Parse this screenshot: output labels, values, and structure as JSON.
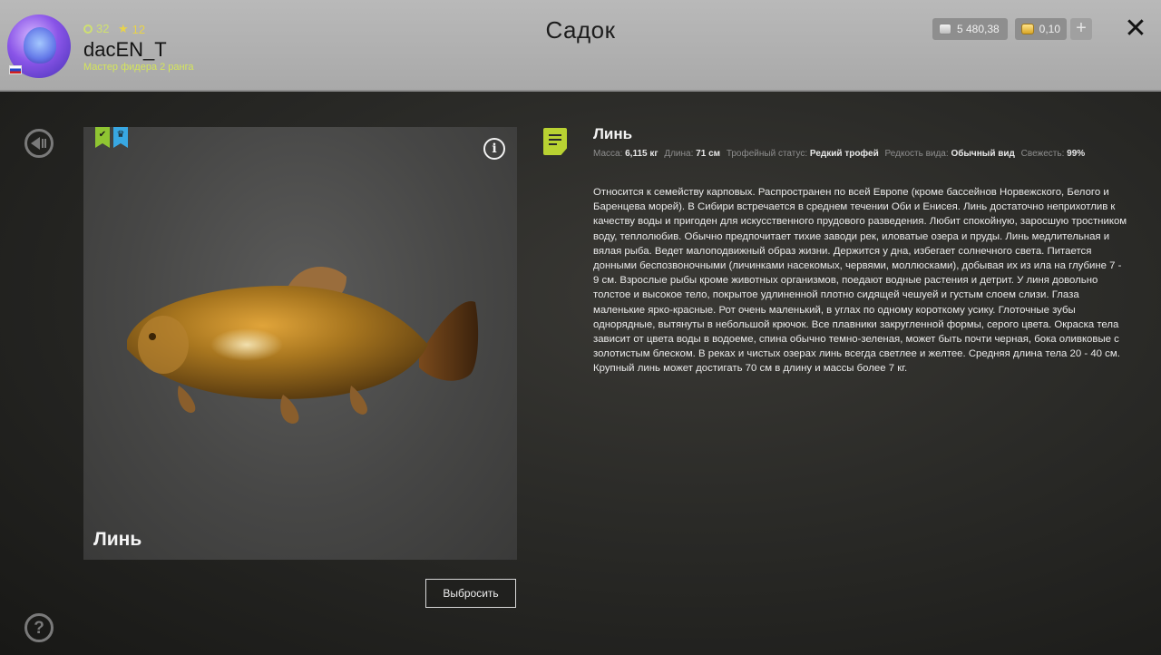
{
  "header": {
    "title": "Садок",
    "username": "dacEN_T",
    "rank": "Мастер фидера 2 ранга",
    "coins_count": "32",
    "stars_count": "12",
    "silver_balance": "5 480,38",
    "gold_balance": "0,10",
    "plus_label": "+",
    "close_label": "✕"
  },
  "fish": {
    "panel_name": "Линь",
    "discard_label": "Выбросить"
  },
  "info": {
    "title": "Линь",
    "mass_label": "Масса:",
    "mass_value": "6,115 кг",
    "length_label": "Длина:",
    "length_value": "71 см",
    "trophy_label": "Трофейный статус:",
    "trophy_value": "Редкий трофей",
    "rarity_label": "Редкость вида:",
    "rarity_value": "Обычный вид",
    "fresh_label": "Свежесть:",
    "fresh_value": "99%",
    "description": "Относится к семейству карповых. Распространен по всей Европе (кроме бассейнов Норвежского, Белого и Баренцева морей). В Сибири встречается в среднем течении Оби и Енисея. Линь достаточно неприхотлив к качеству воды и пригоден для искусственного прудового разведения. Любит спокойную, заросшую тростником воду, теплолюбив. Обычно предпочитает тихие заводи рек, иловатые озера и пруды. Линь медлительная и вялая рыба. Ведет малоподвижный образ жизни. Держится у дна, избегает солнечного света. Питается донными беспозвоночными (личинками насекомых, червями, моллюсками), добывая их из ила на глубине 7 - 9 см. Взрослые рыбы кроме животных организмов, поедают водные растения и детрит. У линя довольно толстое и высокое тело, покрытое удлиненной плотно сидящей чешуей и густым слоем слизи. Глаза маленькие ярко-красные. Рот очень маленький, в углах по одному короткому усику. Глоточные зубы однорядные, вытянуты в небольшой крючок. Все плавники закругленной формы, серого цвета. Окраска тела зависит от цвета воды в водоеме, спина обычно темно-зеленая, может быть почти черная, бока оливковые с золотистым блеском. В реках и чистых озерах линь всегда светлее и желтее. Средняя длина тела 20 - 40 см. Крупный линь может достигать 70 см в длину и массы более 7 кг."
  },
  "colors": {
    "accent_green": "#b9d232",
    "bookmark_green": "#8fc532",
    "bookmark_blue": "#38a7e2"
  }
}
